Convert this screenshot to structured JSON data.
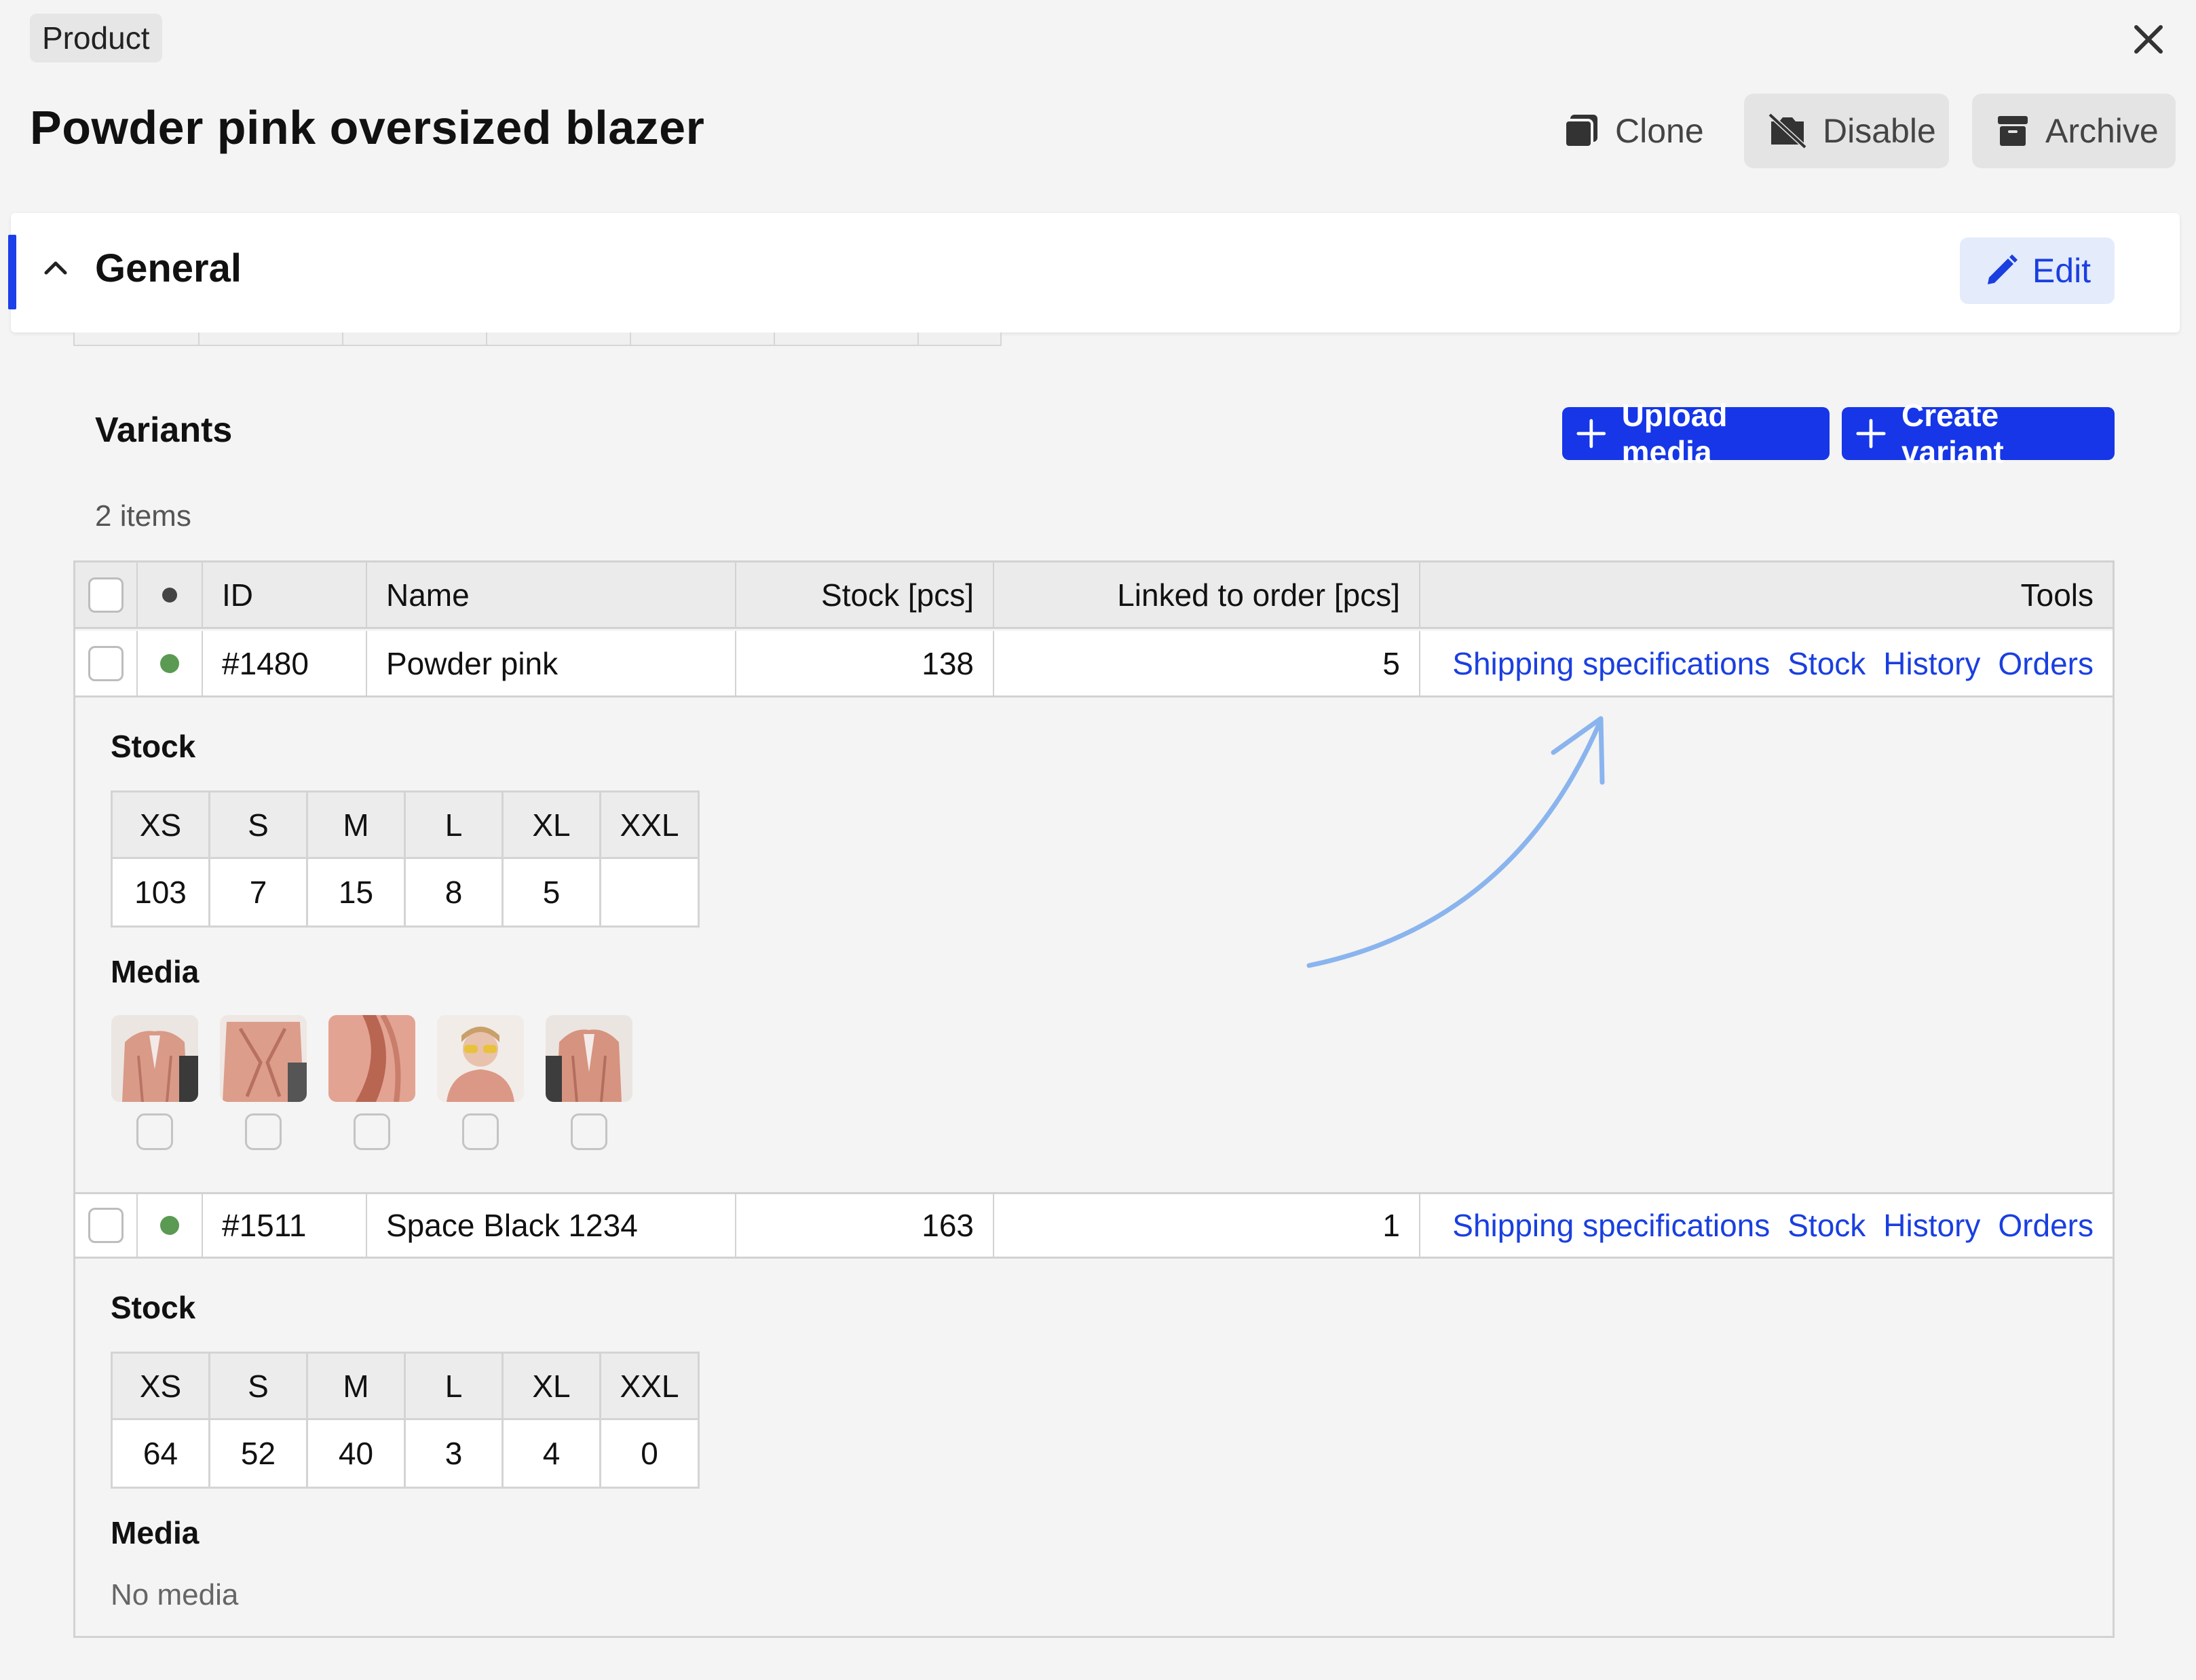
{
  "header": {
    "breadcrumb": "Product",
    "title": "Powder pink oversized blazer",
    "actions": {
      "clone": "Clone",
      "disable": "Disable",
      "archive": "Archive"
    }
  },
  "section": {
    "title": "General",
    "edit_label": "Edit"
  },
  "variants": {
    "title": "Variants",
    "upload_label": "Upload media",
    "create_label": "Create variant",
    "count_text": "2 items",
    "columns": {
      "id": "ID",
      "name": "Name",
      "stock": "Stock [pcs]",
      "linked": "Linked to order [pcs]",
      "tools": "Tools"
    },
    "tools": {
      "shipping": "Shipping specifications",
      "stock": "Stock",
      "history": "History",
      "orders": "Orders"
    },
    "stock_label": "Stock",
    "media_label": "Media",
    "sizes": [
      "XS",
      "S",
      "M",
      "L",
      "XL",
      "XXL"
    ],
    "rows": [
      {
        "id": "#1480",
        "name": "Powder pink",
        "stock": "138",
        "linked": "5",
        "status_color": "#5a9a52",
        "sizes": [
          "103",
          "7",
          "15",
          "8",
          "5",
          ""
        ],
        "media_count": 5
      },
      {
        "id": "#1511",
        "name": "Space Black 1234",
        "stock": "163",
        "linked": "1",
        "status_color": "#5a9a52",
        "sizes": [
          "64",
          "52",
          "40",
          "3",
          "4",
          "0"
        ],
        "no_media": "No media"
      }
    ]
  },
  "colors": {
    "accent": "#1b3fe8",
    "primary_button": "#1636e8",
    "link": "#1a3fe0",
    "annotation_arrow": "#8ab4ee"
  }
}
